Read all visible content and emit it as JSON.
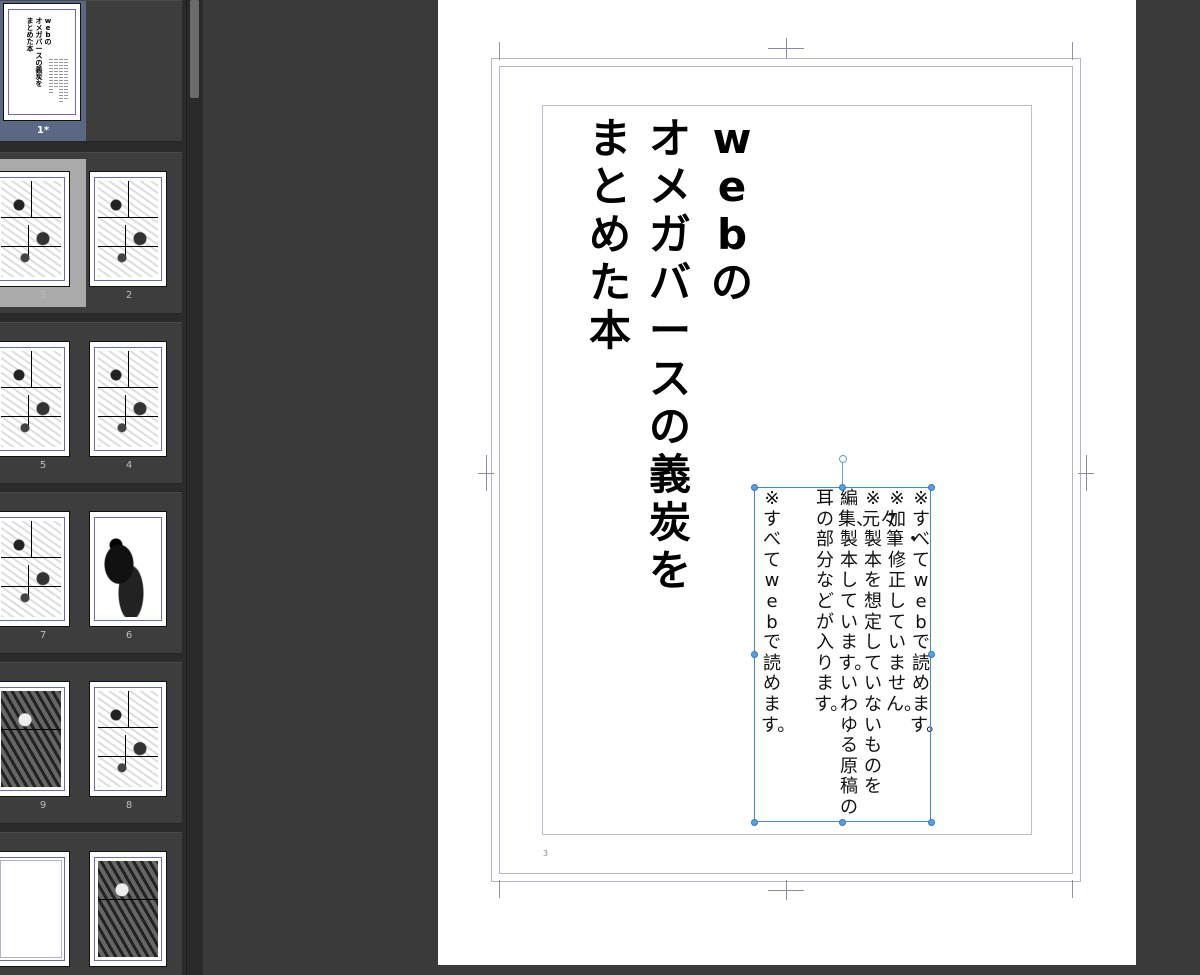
{
  "colors": {
    "app_background": "#3a3a3a",
    "panel_background": "#2b2b2b",
    "selection_blue": "#3b8ed6",
    "selected_page_highlight": "#aaaaaa"
  },
  "page_panel": {
    "spreads": [
      {
        "pages": [
          {
            "label": "1*",
            "selected": true,
            "kind": "cover"
          }
        ]
      },
      {
        "pages": [
          {
            "label": "3",
            "selected": true,
            "kind": "manga"
          },
          {
            "label": "2",
            "selected": false,
            "kind": "manga"
          }
        ]
      },
      {
        "pages": [
          {
            "label": "5",
            "selected": false,
            "kind": "manga"
          },
          {
            "label": "4",
            "selected": false,
            "kind": "manga"
          }
        ]
      },
      {
        "pages": [
          {
            "label": "7",
            "selected": false,
            "kind": "manga"
          },
          {
            "label": "6",
            "selected": false,
            "kind": "figure"
          }
        ]
      },
      {
        "pages": [
          {
            "label": "9",
            "selected": false,
            "kind": "dark"
          },
          {
            "label": "8",
            "selected": false,
            "kind": "manga"
          }
        ]
      },
      {
        "pages": [
          {
            "label": "",
            "selected": false,
            "kind": "blank"
          },
          {
            "label": "",
            "selected": false,
            "kind": "dark"
          }
        ]
      }
    ]
  },
  "document": {
    "title_columns": [
      "webの",
      "オメガバースの義炭を",
      "まとめた本"
    ],
    "note_columns": [
      "※すべてwebで読めます。",
      "※加筆・修正していません。",
      "※元々製本を想定していないものを",
      "編集、製本しています。いわゆる原稿の",
      "耳の部分などが入ります。",
      "※すべてwebで読めます。"
    ],
    "page_number": "3"
  }
}
